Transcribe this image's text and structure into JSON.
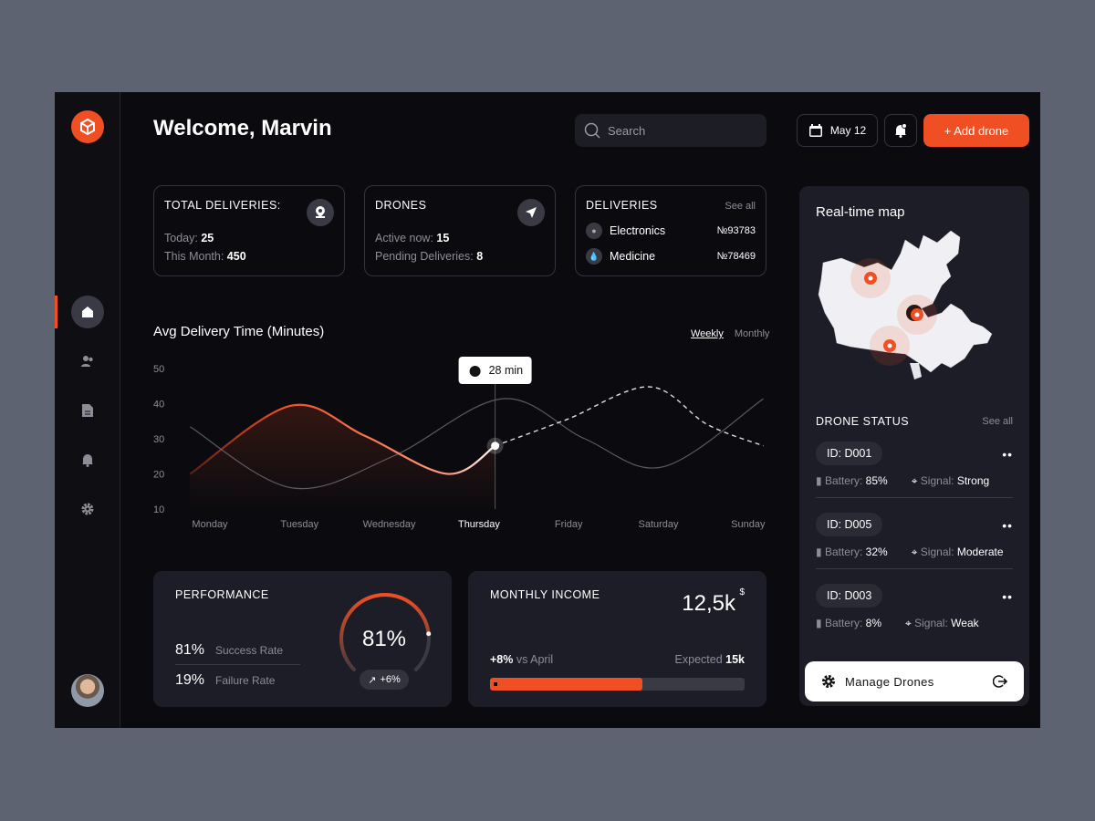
{
  "header": {
    "title": "Welcome, Marvin",
    "search_placeholder": "Search",
    "date": "May 12",
    "add_label": "+ Add drone"
  },
  "sidebar": {
    "items": [
      "home",
      "users",
      "documents",
      "notifications",
      "settings"
    ]
  },
  "cards": {
    "total": {
      "title": "TOTAL DELIVERIES:",
      "today_label": "Today:",
      "today": "25",
      "month_label": "This Month:",
      "month": "450"
    },
    "drones": {
      "title": "DRONES",
      "active_label": "Active now:",
      "active": "15",
      "pending_label": "Pending Deliveries:",
      "pending": "8"
    },
    "deliveries": {
      "title": "DELIVERIES",
      "see_all": "See all",
      "items": [
        {
          "name": "Electronics",
          "id": "№93783"
        },
        {
          "name": "Medicine",
          "id": "№78469"
        }
      ]
    }
  },
  "chart_data": {
    "type": "line",
    "title": "Avg Delivery Time (Minutes)",
    "tabs": [
      "Weekly",
      "Monthly"
    ],
    "categories": [
      "Monday",
      "Tuesday",
      "Wednesday",
      "Thursday",
      "Friday",
      "Saturday",
      "Sunday"
    ],
    "yticks": [
      50,
      40,
      30,
      20,
      10
    ],
    "ylim": [
      10,
      50
    ],
    "series": [
      {
        "name": "current",
        "x": [
          -0.22,
          0.9,
          1.73,
          2.65,
          3.18,
          3.98,
          4.9,
          5.55,
          6.17
        ],
        "y": [
          20,
          39.4,
          30.8,
          20,
          28,
          35.5,
          44.8,
          34,
          28
        ]
      },
      {
        "name": "previous",
        "x": [
          -0.22,
          0.92,
          2.04,
          3.26,
          4.18,
          5.05,
          6.17
        ],
        "y": [
          33.4,
          16,
          25,
          41.4,
          30,
          22,
          41.4
        ]
      }
    ],
    "highlight": {
      "x": 3.18,
      "y": 28,
      "label": "28 min"
    },
    "active_category": "Thursday"
  },
  "performance": {
    "title": "PERFORMANCE",
    "success": "81%",
    "success_label": "Success Rate",
    "failure": "19%",
    "failure_label": "Failure Rate",
    "gauge_value": 81,
    "gauge_label": "81%",
    "trend": "+6%"
  },
  "income": {
    "title": "MONTHLY INCOME",
    "value": "12,5k",
    "currency": "$",
    "change": "+8%",
    "change_label": "vs April",
    "expected_label": "Expected",
    "expected": "15k",
    "progress": 0.6
  },
  "map": {
    "title": "Real-time map"
  },
  "drone_status": {
    "title": "DRONE STATUS",
    "see_all": "See all",
    "items": [
      {
        "id": "ID: D001",
        "battery_label": "Battery:",
        "battery": "85%",
        "signal_label": "Signal:",
        "signal": "Strong"
      },
      {
        "id": "ID: D005",
        "battery_label": "Battery:",
        "battery": "32%",
        "signal_label": "Signal:",
        "signal": "Moderate"
      },
      {
        "id": "ID: D003",
        "battery_label": "Battery:",
        "battery": "8%",
        "signal_label": "Signal:",
        "signal": "Weak"
      }
    ],
    "manage_label": "Manage Drones"
  },
  "colors": {
    "accent": "#f04e23",
    "bg": "#0b0b0f",
    "panel": "#1d1d28"
  }
}
